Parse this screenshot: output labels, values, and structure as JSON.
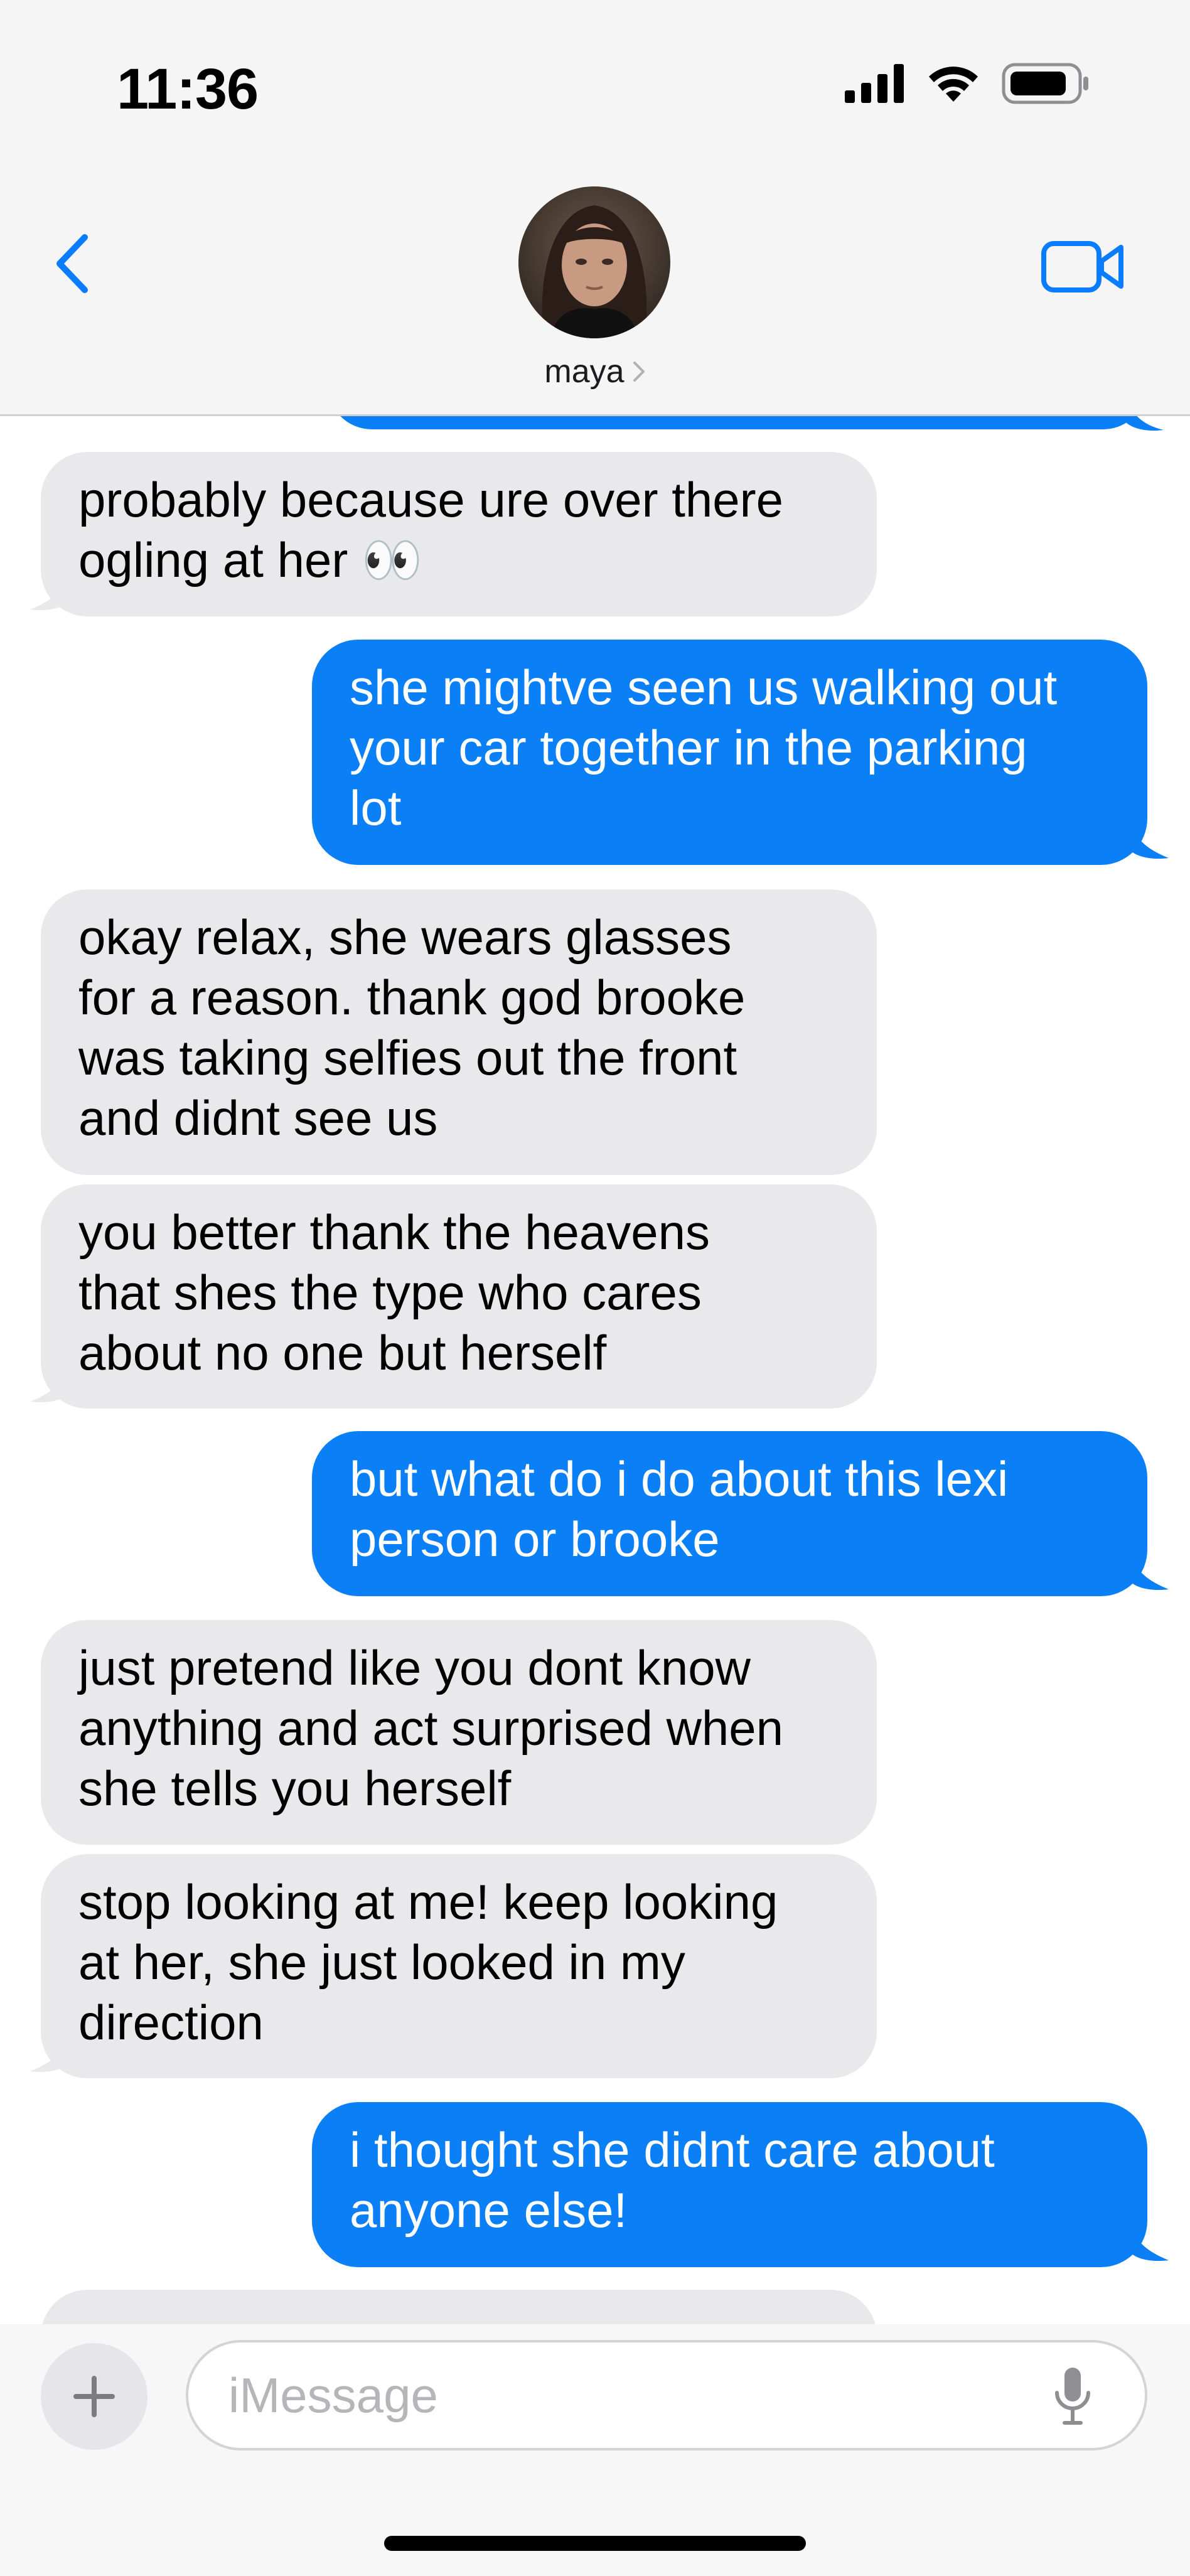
{
  "status_bar": {
    "time": "11:36"
  },
  "header": {
    "contact_name": "maya",
    "icons": {
      "back": "chevron-left-icon",
      "video": "video-camera-icon",
      "chevron": "chevron-right-icon"
    }
  },
  "messages": [
    {
      "direction": "out",
      "text": "",
      "partial": true
    },
    {
      "direction": "in",
      "text": "probably because ure over there\nogling at her 👀"
    },
    {
      "direction": "out",
      "text": "she mightve seen us walking out\nyour car together in the parking\nlot"
    },
    {
      "direction": "in",
      "text": "okay relax, she wears glasses\nfor a reason. thank god brooke\nwas taking selfies out the front\nand didnt see us"
    },
    {
      "direction": "in",
      "text": "you better thank the heavens\nthat shes the type who cares\nabout no one but herself"
    },
    {
      "direction": "out",
      "text": "but what do i do about this lexi\nperson or brooke"
    },
    {
      "direction": "in",
      "text": "just pretend like you dont know\nanything and act surprised when\nshe tells you herself"
    },
    {
      "direction": "in",
      "text": "stop looking at me! keep looking\nat her, she just looked in my\ndirection"
    },
    {
      "direction": "out",
      "text": "i thought she didnt care about\nanyone else!"
    },
    {
      "direction": "in",
      "text": "",
      "partial": true
    }
  ],
  "composer": {
    "placeholder": "iMessage",
    "value": "",
    "icons": {
      "plus": "plus-icon",
      "mic": "microphone-icon"
    }
  },
  "colors": {
    "outgoing_bubble": "#0b7ff5",
    "incoming_bubble": "#e9e9eb",
    "accent": "#0a7cff"
  }
}
